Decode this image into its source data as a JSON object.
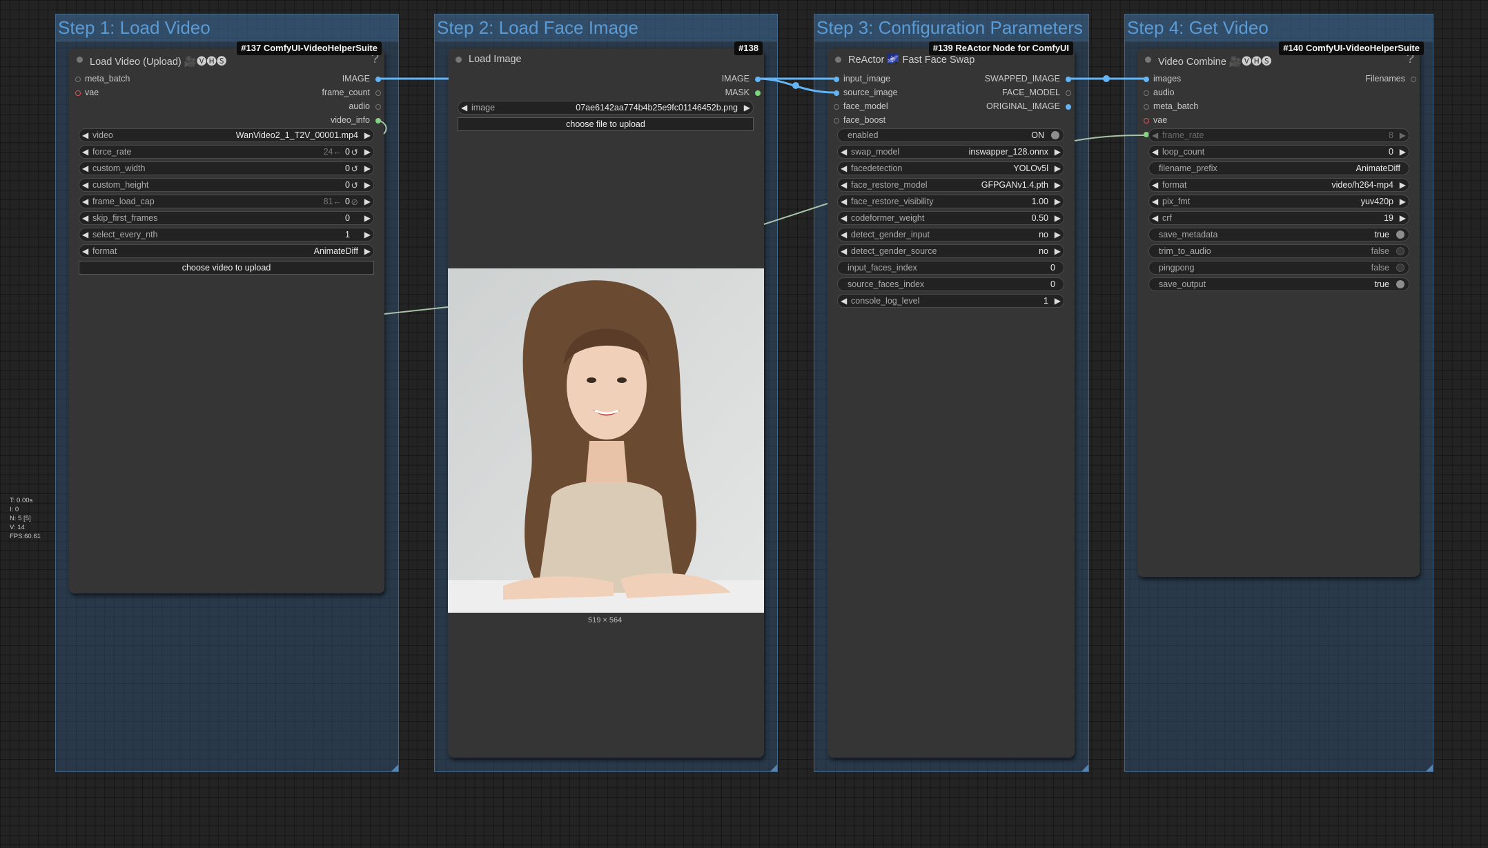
{
  "groups": [
    {
      "title": "Step 1:  Load Video"
    },
    {
      "title": "Step 2:  Load Face Image"
    },
    {
      "title": "Step 3:  Configuration Parameters"
    },
    {
      "title": "Step 4:  Get Video"
    }
  ],
  "node137": {
    "badge": "#137 ComfyUI-VideoHelperSuite",
    "title": "Load Video (Upload) 🎥🅥🅗🅢",
    "help": "?",
    "inputs": [
      "meta_batch",
      "vae"
    ],
    "outputs": [
      "IMAGE",
      "frame_count",
      "audio",
      "video_info"
    ],
    "widgets": [
      {
        "name": "video",
        "value": "WanVideo2_1_T2V_00001.mp4"
      },
      {
        "name": "force_rate",
        "value": "0",
        "extra": "24←",
        "reset": "↺"
      },
      {
        "name": "custom_width",
        "value": "0",
        "reset": "↺"
      },
      {
        "name": "custom_height",
        "value": "0",
        "reset": "↺"
      },
      {
        "name": "frame_load_cap",
        "value": "0",
        "extra": "81←",
        "reset": "⊘"
      },
      {
        "name": "skip_first_frames",
        "value": "0"
      },
      {
        "name": "select_every_nth",
        "value": "1"
      },
      {
        "name": "format",
        "value": "AnimateDiff"
      }
    ],
    "upload_button": "choose video to upload"
  },
  "node138": {
    "badge": "#138",
    "title": "Load Image",
    "outputs": [
      "IMAGE",
      "MASK"
    ],
    "image_widget": {
      "name": "image",
      "value": "07ae6142aa774b4b25e9fc01146452b.png"
    },
    "upload_button": "choose file to upload",
    "preview_size": "519 × 564"
  },
  "node139": {
    "badge": "#139 ReActor Node for ComfyUI",
    "title": "ReActor 🌌 Fast Face Swap",
    "inputs": [
      "input_image",
      "source_image",
      "face_model",
      "face_boost"
    ],
    "outputs": [
      "SWAPPED_IMAGE",
      "FACE_MODEL",
      "ORIGINAL_IMAGE"
    ],
    "enabled": {
      "name": "enabled",
      "value": "ON"
    },
    "widgets": [
      {
        "name": "swap_model",
        "value": "inswapper_128.onnx"
      },
      {
        "name": "facedetection",
        "value": "YOLOv5l"
      },
      {
        "name": "face_restore_model",
        "value": "GFPGANv1.4.pth"
      },
      {
        "name": "face_restore_visibility",
        "value": "1.00"
      },
      {
        "name": "codeformer_weight",
        "value": "0.50"
      },
      {
        "name": "detect_gender_input",
        "value": "no"
      },
      {
        "name": "detect_gender_source",
        "value": "no"
      }
    ],
    "plain_widgets": [
      {
        "name": "input_faces_index",
        "value": "0"
      },
      {
        "name": "source_faces_index",
        "value": "0"
      }
    ],
    "console": {
      "name": "console_log_level",
      "value": "1"
    }
  },
  "node140": {
    "badge": "#140 ComfyUI-VideoHelperSuite",
    "title": "Video Combine 🎥🅥🅗🅢",
    "help": "?",
    "inputs": [
      "images",
      "audio",
      "meta_batch",
      "vae"
    ],
    "outputs": [
      "Filenames"
    ],
    "frame_rate": {
      "name": "frame_rate",
      "value": "8"
    },
    "loop_count": {
      "name": "loop_count",
      "value": "0"
    },
    "filename_prefix": {
      "name": "filename_prefix",
      "value": "AnimateDiff"
    },
    "widgets": [
      {
        "name": "format",
        "value": "video/h264-mp4"
      },
      {
        "name": "pix_fmt",
        "value": "yuv420p"
      },
      {
        "name": "crf",
        "value": "19"
      }
    ],
    "toggles": [
      {
        "name": "save_metadata",
        "value": "true",
        "on": true
      },
      {
        "name": "trim_to_audio",
        "value": "false",
        "on": false
      },
      {
        "name": "pingpong",
        "value": "false",
        "on": false
      },
      {
        "name": "save_output",
        "value": "true",
        "on": true
      }
    ]
  },
  "stats": [
    "T: 0.00s",
    "I: 0",
    "N: 5 [5]",
    "V: 14",
    "FPS:60.61"
  ],
  "colors": {
    "image_link": "#64b5f6",
    "group_fill": "#345f8a",
    "canvas": "#232323"
  }
}
